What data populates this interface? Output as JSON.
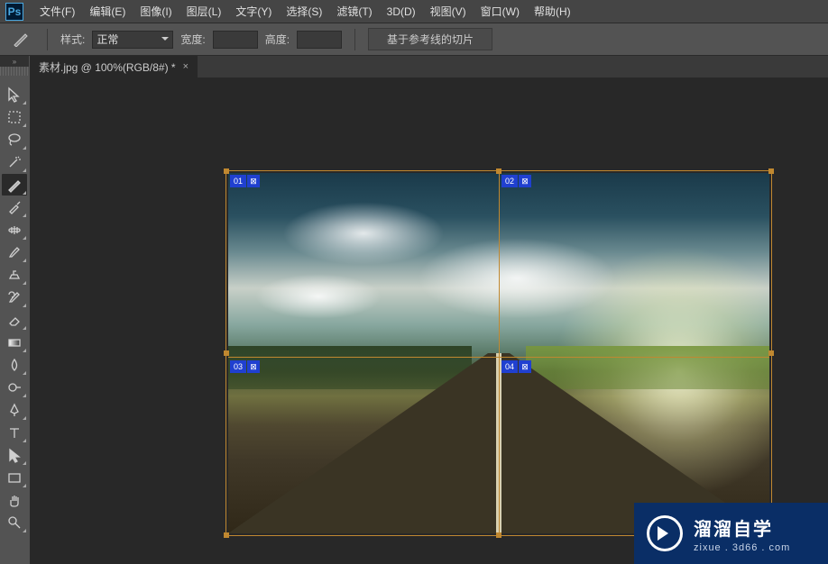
{
  "app": {
    "logo": "Ps"
  },
  "menu": [
    "文件(F)",
    "编辑(E)",
    "图像(I)",
    "图层(L)",
    "文字(Y)",
    "选择(S)",
    "滤镜(T)",
    "3D(D)",
    "视图(V)",
    "窗口(W)",
    "帮助(H)"
  ],
  "options": {
    "style_label": "样式:",
    "style_value": "正常",
    "width_label": "宽度:",
    "width_value": "",
    "height_label": "高度:",
    "height_value": "",
    "guide_button": "基于参考线的切片"
  },
  "document": {
    "tab_title": "素材.jpg @ 100%(RGB/8#) *"
  },
  "slices": {
    "s1": "01",
    "s2": "02",
    "s3": "03",
    "s4": "04"
  },
  "watermark": {
    "title": "溜溜自学",
    "sub": "zixue . 3d66 . com"
  }
}
